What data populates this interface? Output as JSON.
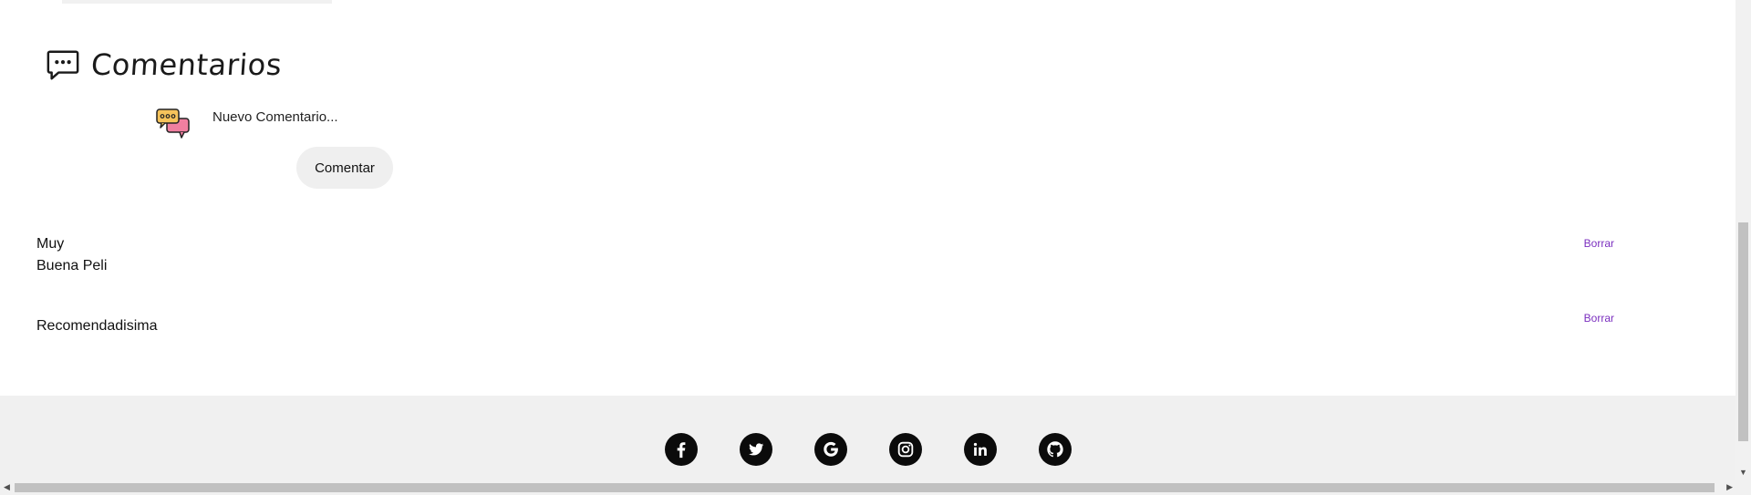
{
  "comments": {
    "title": "Comentarios",
    "title_icon": "speech-bubble-dots-icon",
    "new_comment": {
      "placeholder": "Nuevo Comentario...",
      "avatar_icon": "chat-bubbles-icon",
      "submit_label": "Comentar"
    },
    "items": [
      {
        "text": "Muy\nBuena Peli",
        "delete_label": "Borrar"
      },
      {
        "text": "Recomendadisima",
        "delete_label": "Borrar"
      }
    ]
  },
  "footer": {
    "socials": [
      {
        "name": "facebook",
        "icon": "facebook-icon"
      },
      {
        "name": "twitter",
        "icon": "twitter-icon"
      },
      {
        "name": "google",
        "icon": "google-icon"
      },
      {
        "name": "instagram",
        "icon": "instagram-icon"
      },
      {
        "name": "linkedin",
        "icon": "linkedin-icon"
      },
      {
        "name": "github",
        "icon": "github-icon"
      }
    ]
  },
  "colors": {
    "link": "#7b2fbf",
    "footer_bg": "#f0f0f0",
    "button_bg": "#efefef"
  }
}
